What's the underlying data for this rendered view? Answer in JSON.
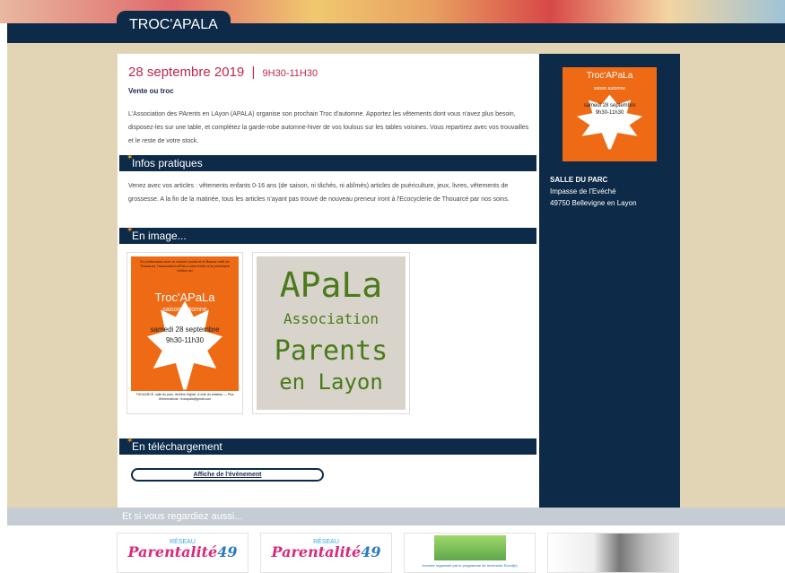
{
  "header": {
    "site_title": "TROC'APALA"
  },
  "event": {
    "date": "28 septembre 2019",
    "separator": "|",
    "time": "9H30-11H30",
    "subtitle": "Vente ou troc",
    "intro": "L'Association des PArents en LAyon (APALA) organise son prochain Troc d'automne. Apportez les vêtements dont vous n'avez plus besoin, disposez-les sur une table, et complétez la garde-robe automne-hiver de vos loulous sur les tables voisines. Vous repartirez avec vos trouvailles et le reste de votre stock."
  },
  "sections": {
    "infos": {
      "title": "Infos pratiques",
      "text": "Venez avec vos articles : vêtements enfants 0-16 ans (de saison, ni tâchés, ni abîmés) articles de puériculture, jeux, livres, vêtements de grossesse. A la fin de la matinée, tous les articles n'ayant pas trouvé de nouveau preneur iront à l'Ecocyclerie de Thouarcé par nos soins."
    },
    "images": {
      "title": "En image..."
    },
    "downloads": {
      "title": "En téléchargement",
      "link_label": "Affiche de l'évènement"
    }
  },
  "poster": {
    "top_text": "En partenariat avec le ressort social et le Bazarr café de Thouarcé, l'association APaLa vous invite à la prochaine édition du",
    "title": "Troc'APaLa",
    "season": "saison automne",
    "date": "samedi 28 septembre",
    "time": "9h30-11h30",
    "footer": "THOUARCÉ, salle du parc, derrière l'église, à côté du château — Plus d'informations : trocapala@gmail.com"
  },
  "logo": {
    "line1": "APaLa",
    "line2": "Association",
    "line3": "Parents",
    "line4": "en Layon"
  },
  "venue": {
    "name": "SALLE DU PARC",
    "street": "Impasse de l'Evéché",
    "city": "49750 Bellevigne en Layon"
  },
  "related": {
    "heading": "Et si vous regardiez aussi...",
    "reseau": "RÉSEAU",
    "parentalite": "Parentalité",
    "num": "49",
    "t3_caption": "Journée organisée par le programme de recherche Ecout(e)"
  }
}
